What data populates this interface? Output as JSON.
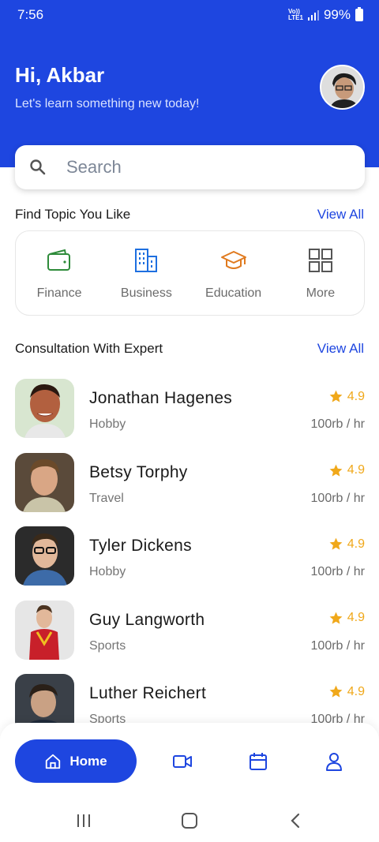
{
  "status_bar": {
    "time": "7:56",
    "network_top": "Vo))",
    "network_bottom": "LTE1",
    "battery": "99%"
  },
  "header": {
    "greeting": "Hi, Akbar",
    "subtitle": "Let's learn something new today!",
    "background_color": "#1e46e0"
  },
  "search": {
    "placeholder": "Search",
    "value": ""
  },
  "topics": {
    "title": "Find Topic You Like",
    "view_all": "View All",
    "items": [
      {
        "label": "Finance",
        "icon": "wallet-icon",
        "color": "#2e8b3a"
      },
      {
        "label": "Business",
        "icon": "building-icon",
        "color": "#1e6fe0"
      },
      {
        "label": "Education",
        "icon": "graduation-cap-icon",
        "color": "#e07a1e"
      },
      {
        "label": "More",
        "icon": "grid-icon",
        "color": "#555555"
      }
    ]
  },
  "experts": {
    "title": "Consultation With Expert",
    "view_all": "View All",
    "items": [
      {
        "name": "Jonathan Hagenes",
        "category": "Hobby",
        "rating": "4.9",
        "rate": "100rb / hr"
      },
      {
        "name": "Betsy Torphy",
        "category": "Travel",
        "rating": "4.9",
        "rate": "100rb / hr"
      },
      {
        "name": "Tyler Dickens",
        "category": "Hobby",
        "rating": "4.9",
        "rate": "100rb / hr"
      },
      {
        "name": "Guy Langworth",
        "category": "Sports",
        "rating": "4.9",
        "rate": "100rb / hr"
      },
      {
        "name": "Luther Reichert",
        "category": "Sports",
        "rating": "4.9",
        "rate": "100rb / hr"
      }
    ]
  },
  "bottom_nav": {
    "home_label": "Home",
    "items": [
      "home-icon",
      "video-icon",
      "calendar-icon",
      "profile-icon"
    ],
    "accent": "#1e46e0"
  },
  "colors": {
    "accent": "#1e46e0",
    "star": "#f0a81a"
  }
}
